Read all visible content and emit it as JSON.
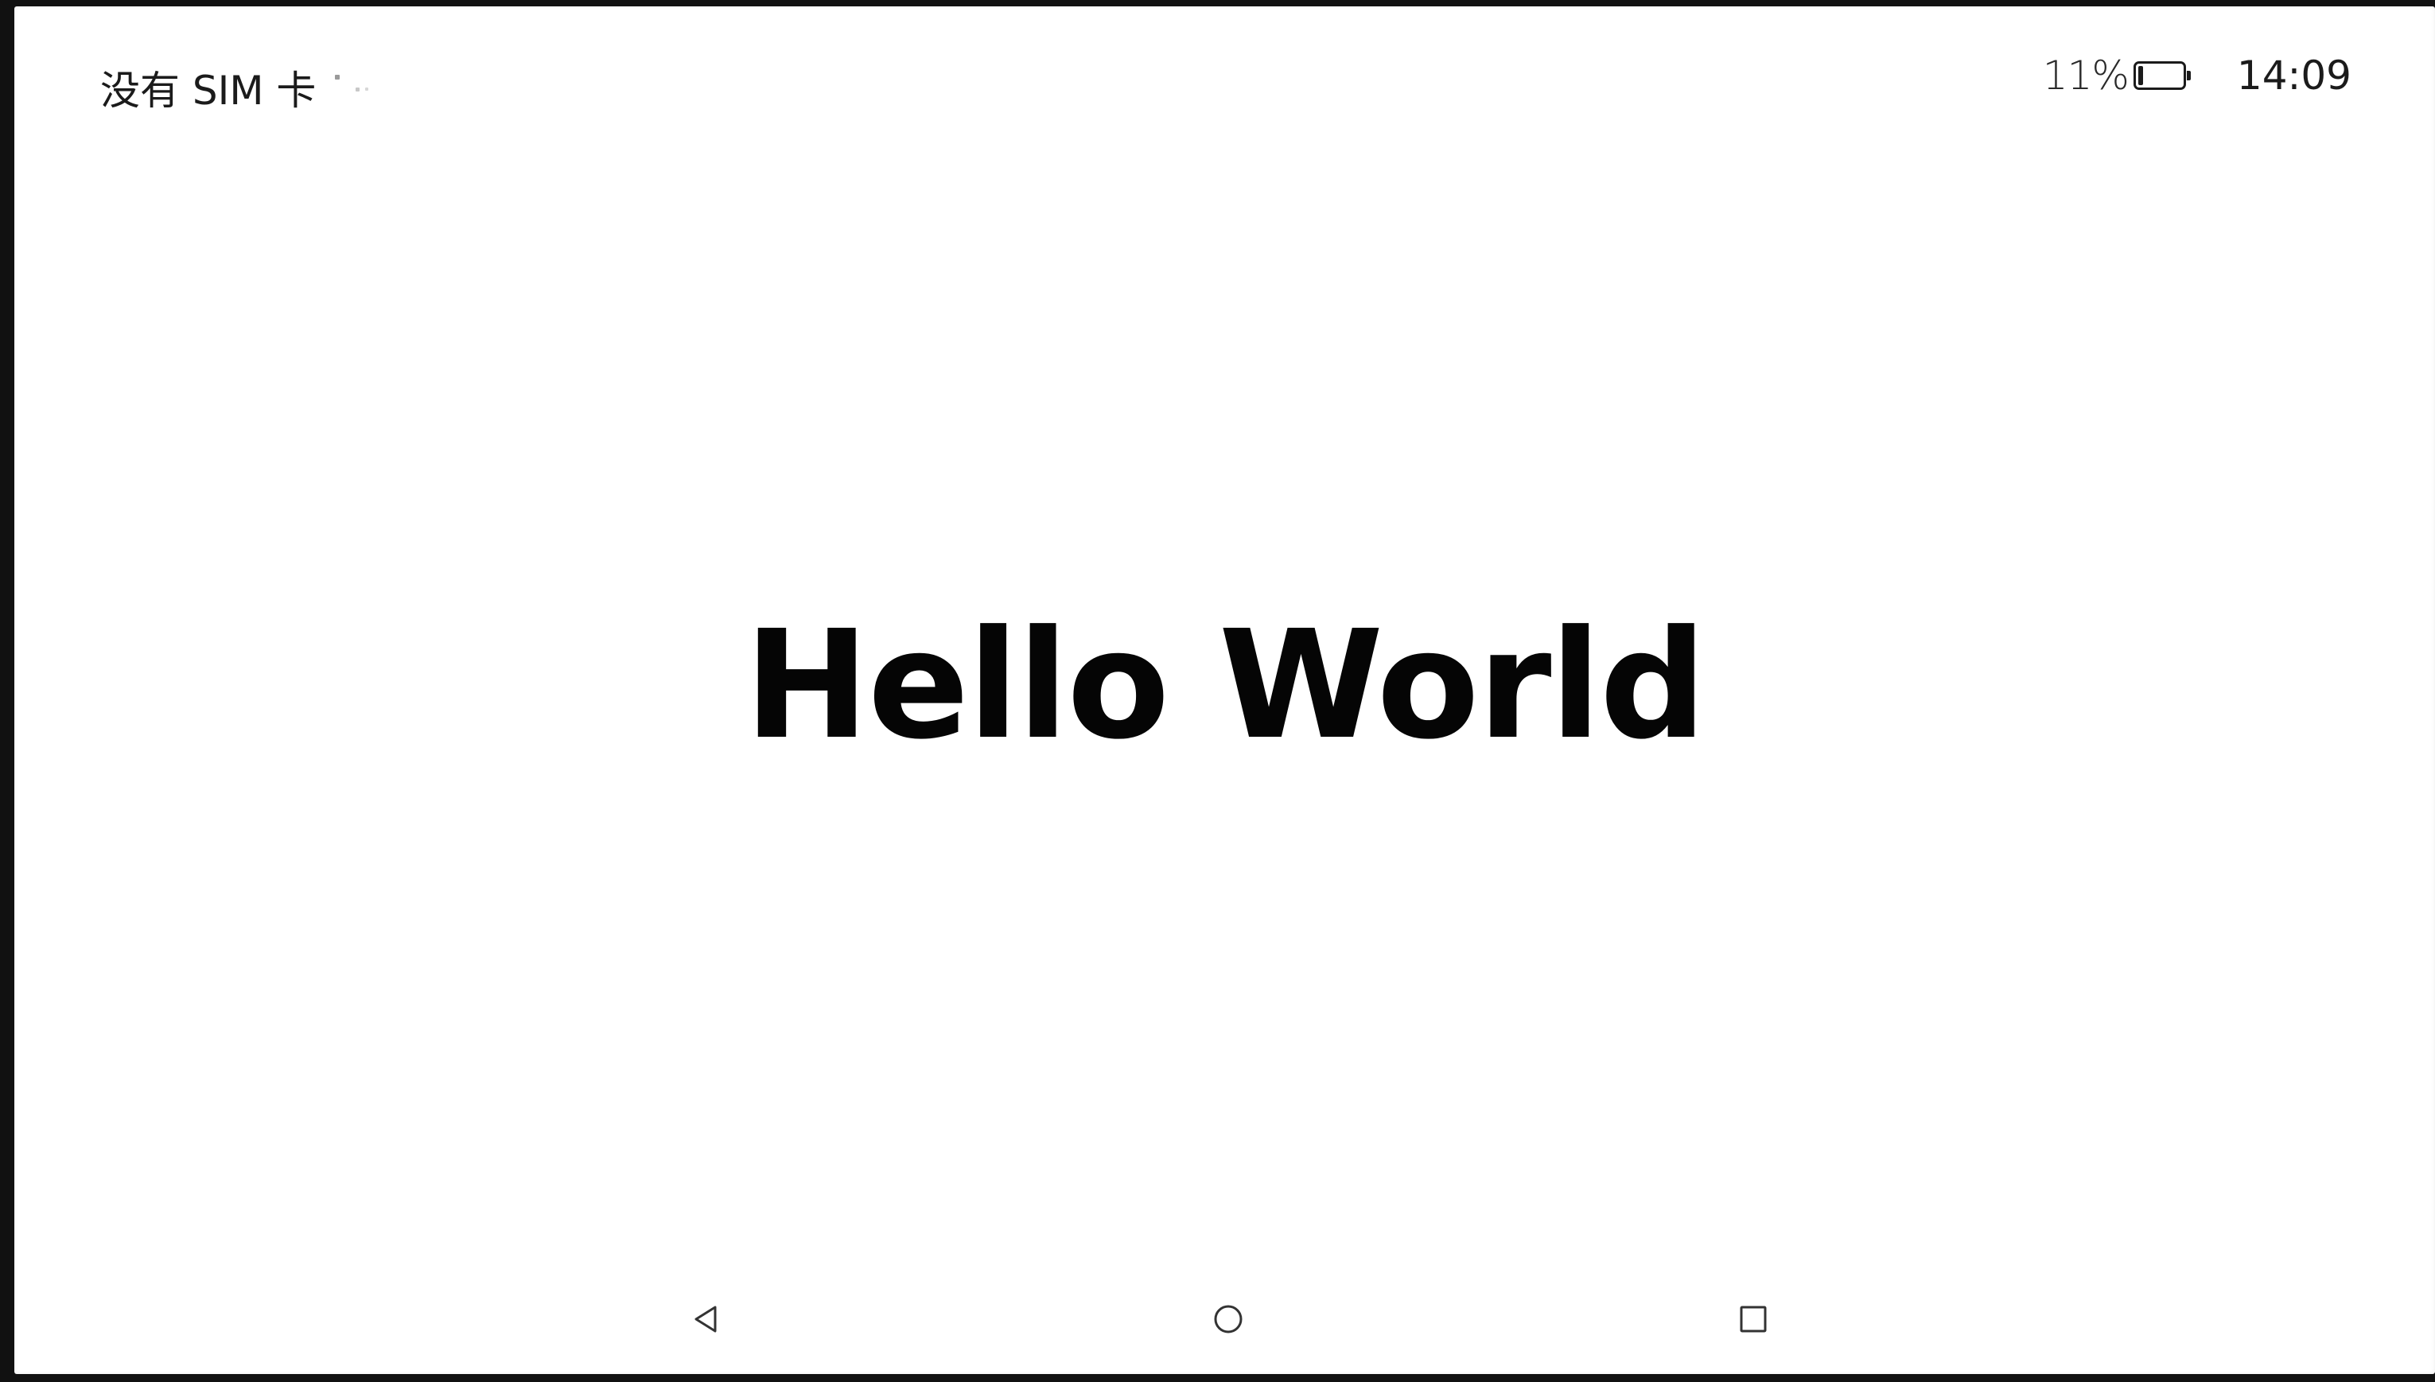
{
  "status_bar": {
    "carrier": "没有 SIM 卡",
    "signal_icon": "signal-icon",
    "battery_percent": "11%",
    "battery_level": 0.11,
    "battery_icon": "battery-icon",
    "time": "14:09"
  },
  "main": {
    "text": "Hello World"
  },
  "nav_bar": {
    "back_icon": "triangle-back-icon",
    "home_icon": "circle-home-icon",
    "recent_icon": "square-recents-icon"
  },
  "colors": {
    "background": "#ffffff",
    "text": "#050505",
    "frame": "#111111"
  }
}
